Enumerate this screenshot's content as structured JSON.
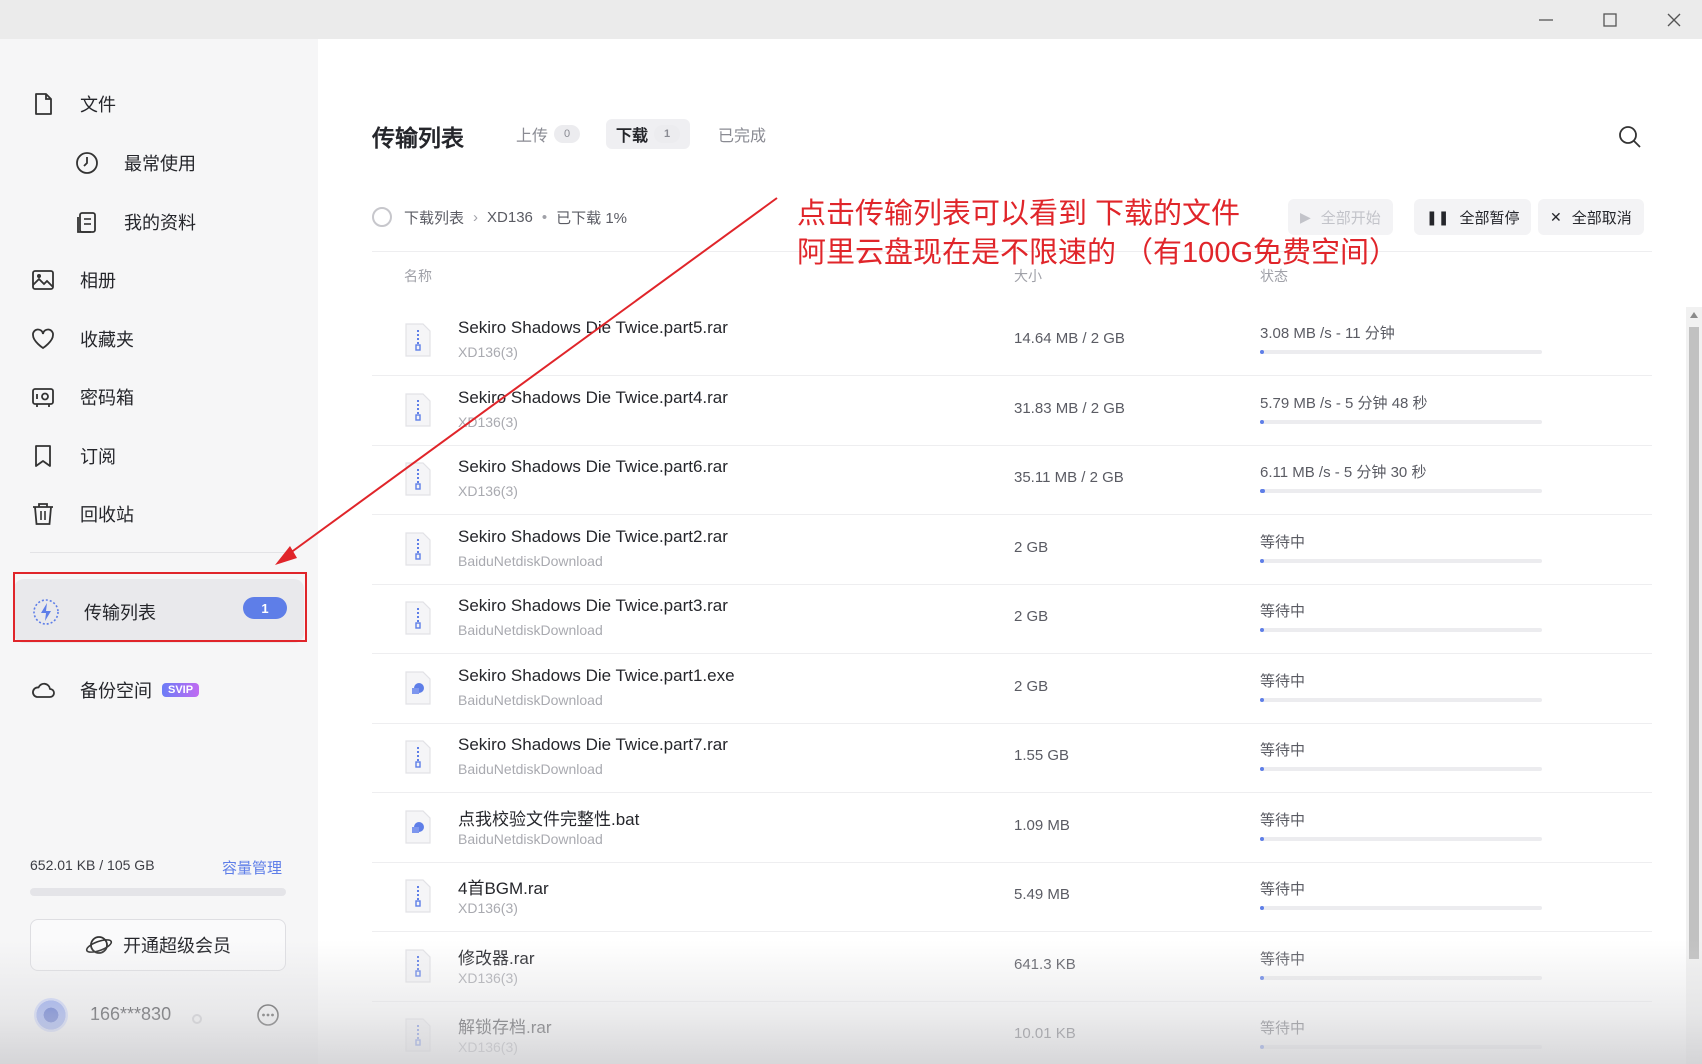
{
  "sidebar": {
    "nav": [
      {
        "label": "文件",
        "icon": "file-icon"
      },
      {
        "label": "最常使用",
        "icon": "clock-icon"
      },
      {
        "label": "我的资料",
        "icon": "documents-icon"
      },
      {
        "label": "相册",
        "icon": "photo-icon"
      },
      {
        "label": "收藏夹",
        "icon": "heart-icon"
      },
      {
        "label": "密码箱",
        "icon": "safe-icon"
      },
      {
        "label": "订阅",
        "icon": "bookmark-icon"
      },
      {
        "label": "回收站",
        "icon": "trash-icon"
      }
    ],
    "transfer": {
      "label": "传输列表",
      "count": "1",
      "icon": "lightning-icon"
    },
    "backup": {
      "label": "备份空间",
      "badge": "SVIP",
      "icon": "cloud-icon"
    },
    "storage": {
      "used": "652.01 KB / 105 GB",
      "manage": "容量管理",
      "fraction": 0.0
    },
    "vip_button": "开通超级会员",
    "user": {
      "name": "166***830"
    }
  },
  "main": {
    "title": "传输列表",
    "tabs": [
      {
        "label": "上传",
        "count": "0"
      },
      {
        "label": "下载",
        "count": "1"
      },
      {
        "label": "已完成",
        "count": ""
      }
    ],
    "breadcrumb": {
      "root": "下载列表",
      "folder": "XD136",
      "progress": "已下载 1%"
    },
    "actions": {
      "start_all": "全部开始",
      "pause_all": "全部暂停",
      "cancel_all": "全部取消"
    },
    "columns": {
      "name": "名称",
      "size": "大小",
      "status": "状态"
    },
    "rows": [
      {
        "name": "Sekiro Shadows Die Twice.part5.rar",
        "path": "XD136(3)",
        "size": "14.64 MB / 2 GB",
        "status": "3.08 MB /s - 11 分钟",
        "progress": 0.01,
        "type": "zip"
      },
      {
        "name": "Sekiro Shadows Die Twice.part4.rar",
        "path": "XD136(3)",
        "size": "31.83 MB / 2 GB",
        "status": "5.79 MB /s - 5 分钟 48 秒",
        "progress": 0.015,
        "type": "zip"
      },
      {
        "name": "Sekiro Shadows Die Twice.part6.rar",
        "path": "XD136(3)",
        "size": "35.11 MB / 2 GB",
        "status": "6.11 MB /s - 5 分钟 30 秒",
        "progress": 0.017,
        "type": "zip"
      },
      {
        "name": "Sekiro Shadows Die Twice.part2.rar",
        "path": "BaiduNetdiskDownload",
        "size": "2 GB",
        "status": "等待中",
        "progress": 0,
        "type": "zip"
      },
      {
        "name": "Sekiro Shadows Die Twice.part3.rar",
        "path": "BaiduNetdiskDownload",
        "size": "2 GB",
        "status": "等待中",
        "progress": 0,
        "type": "zip"
      },
      {
        "name": "Sekiro Shadows Die Twice.part1.exe",
        "path": "BaiduNetdiskDownload",
        "size": "2 GB",
        "status": "等待中",
        "progress": 0,
        "type": "exe"
      },
      {
        "name": "Sekiro Shadows Die Twice.part7.rar",
        "path": "BaiduNetdiskDownload",
        "size": "1.55 GB",
        "status": "等待中",
        "progress": 0,
        "type": "zip"
      },
      {
        "name": "点我校验文件完整性.bat",
        "path": "BaiduNetdiskDownload",
        "size": "1.09 MB",
        "status": "等待中",
        "progress": 0,
        "type": "exe"
      },
      {
        "name": "4首BGM.rar",
        "path": "XD136(3)",
        "size": "5.49 MB",
        "status": "等待中",
        "progress": 0,
        "type": "zip"
      },
      {
        "name": "修改器.rar",
        "path": "XD136(3)",
        "size": "641.3 KB",
        "status": "等待中",
        "progress": 0,
        "type": "zip"
      },
      {
        "name": "解锁存档.rar",
        "path": "XD136(3)",
        "size": "10.01 KB",
        "status": "等待中",
        "progress": 0,
        "type": "zip"
      }
    ]
  },
  "annotation": {
    "line1": "点击传输列表可以看到 下载的文件",
    "line2": "阿里云盘现在是不限速的 （有100G免费空间）"
  },
  "colors": {
    "accent": "#5e7ee8",
    "annotation": "#e0252a"
  }
}
